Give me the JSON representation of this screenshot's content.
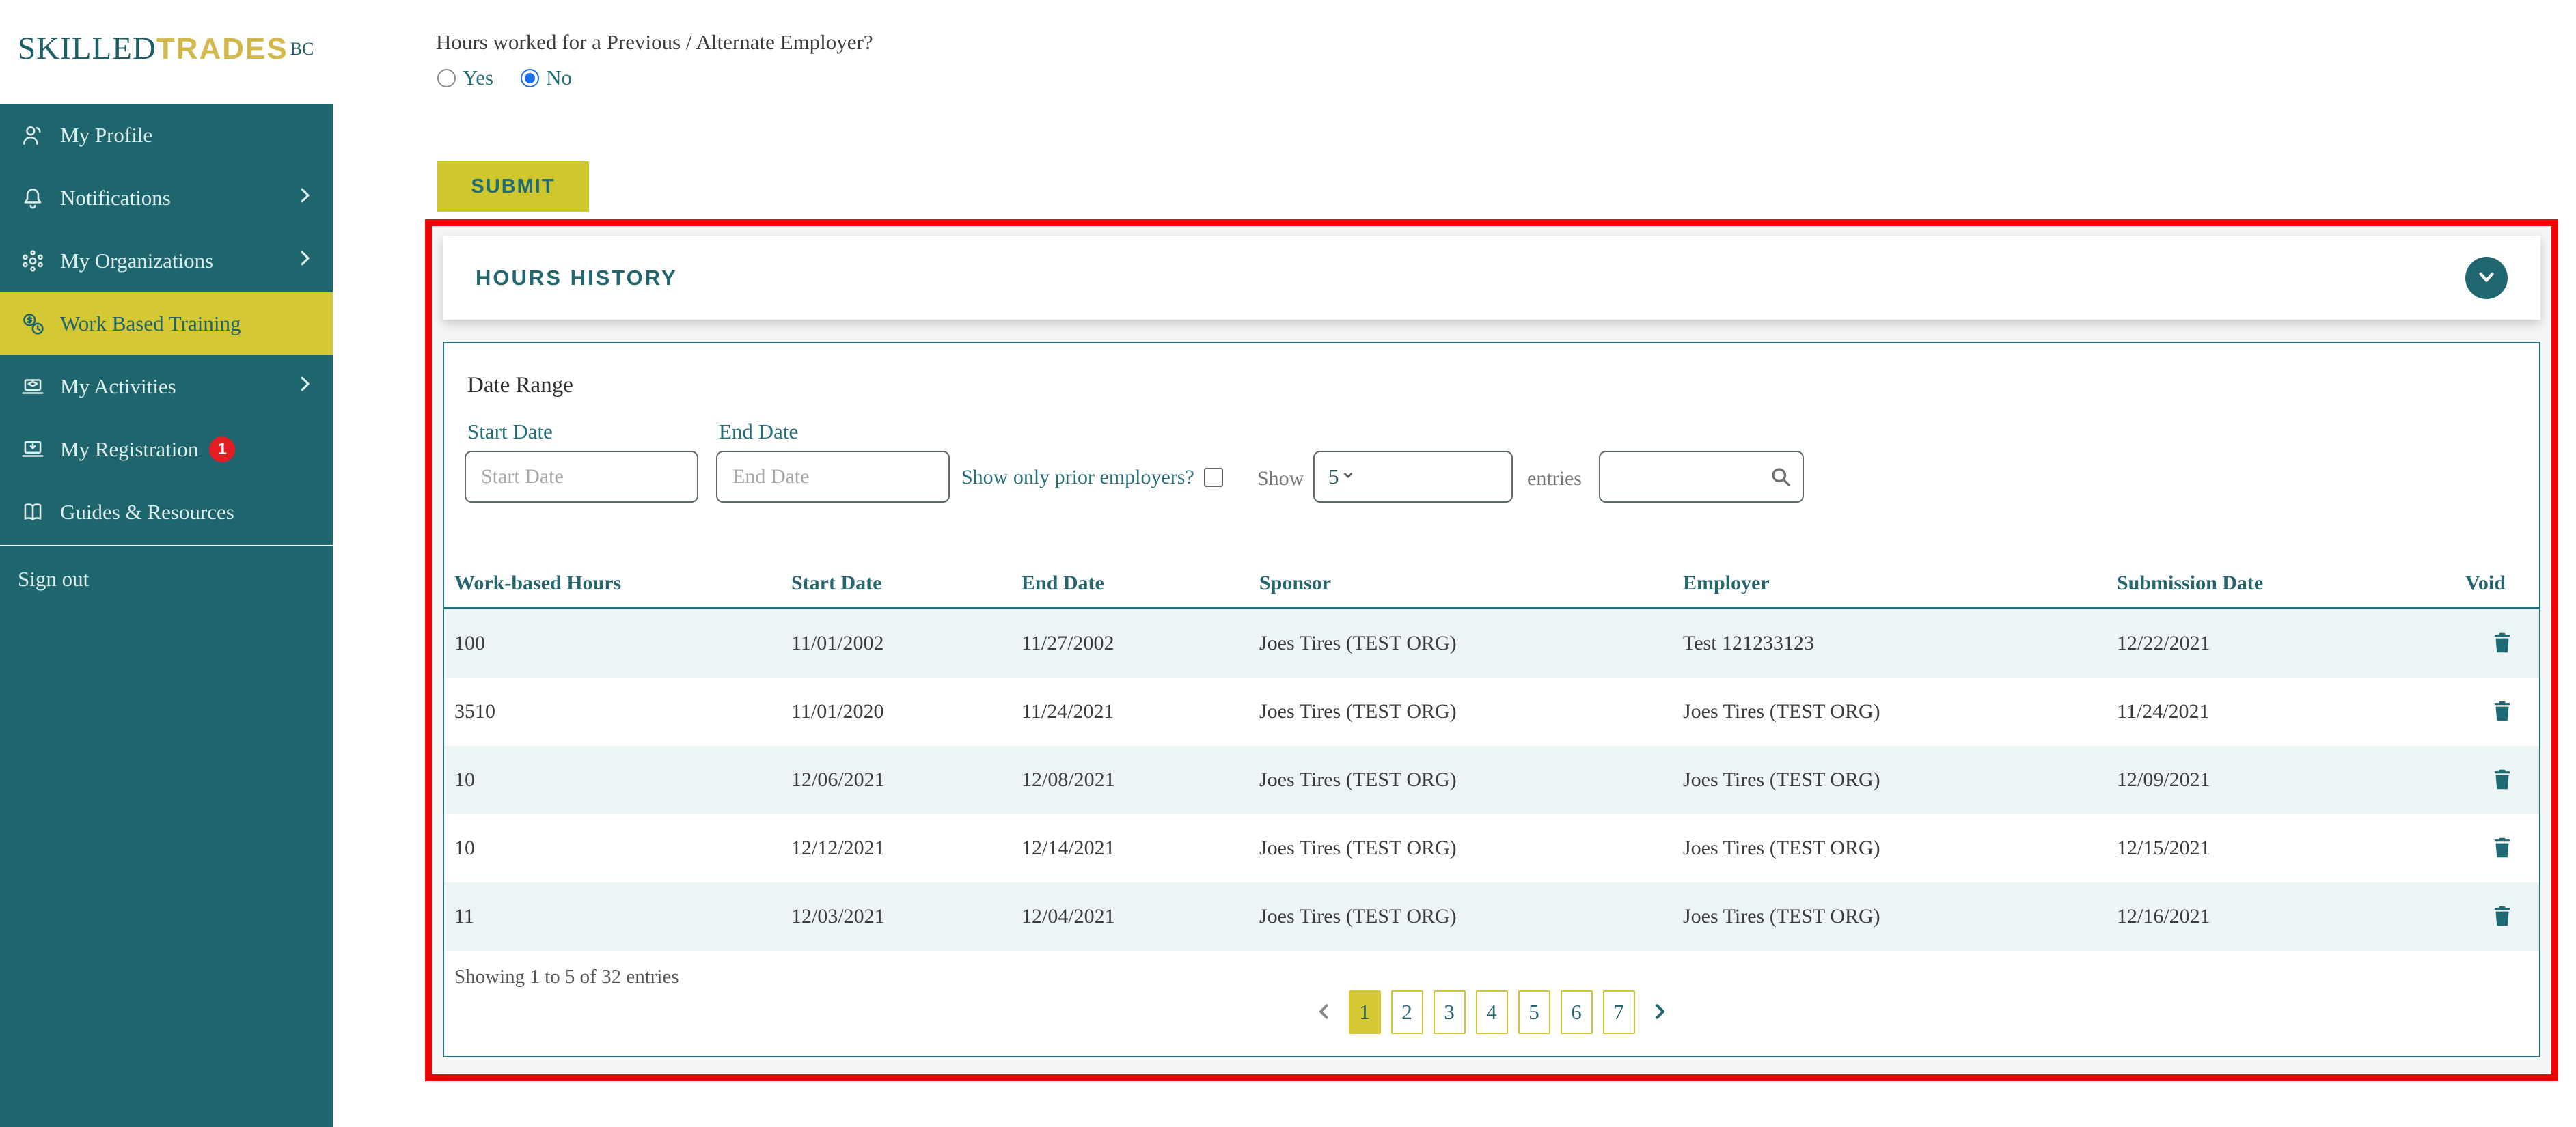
{
  "brand": {
    "skilled": "SKILLED",
    "trades": "TRADES",
    "bc": "BC"
  },
  "colors": {
    "sidebar_teal": "#1f656d",
    "active_yellow": "#d4c935",
    "submit_yellow": "#cfc72e",
    "logo_gold": "#d2b84b",
    "accent_teal_text": "#266e77",
    "highlight_red_border": "#ee0505",
    "badge_red": "#e41c23",
    "row_stripe": "#edf4f6",
    "radio_selected_blue": "#1a6fe8"
  },
  "sidebar": {
    "items": [
      {
        "label": "My Profile",
        "icon": "person-icon",
        "expandable": false,
        "active": false
      },
      {
        "label": "Notifications",
        "icon": "bell-icon",
        "expandable": true,
        "active": false
      },
      {
        "label": "My Organizations",
        "icon": "network-icon",
        "expandable": true,
        "active": false
      },
      {
        "label": "Work Based Training",
        "icon": "work-training-icon",
        "expandable": false,
        "active": true
      },
      {
        "label": "My Activities",
        "icon": "activities-icon",
        "expandable": true,
        "active": false
      },
      {
        "label": "My Registration",
        "icon": "registration-icon",
        "expandable": false,
        "active": false,
        "badge": "1"
      },
      {
        "label": "Guides & Resources",
        "icon": "guides-icon",
        "expandable": false,
        "active": false
      }
    ],
    "sign_out": "Sign out"
  },
  "form": {
    "question": "Hours worked for a Previous / Alternate Employer?",
    "options": [
      {
        "label": "Yes",
        "selected": false
      },
      {
        "label": "No",
        "selected": true
      }
    ],
    "submit_label": "SUBMIT"
  },
  "hours_history": {
    "title": "HOURS HISTORY",
    "date_range": {
      "heading": "Date Range",
      "start_label": "Start Date",
      "start_placeholder": "Start Date",
      "end_label": "End Date",
      "end_placeholder": "End Date"
    },
    "filters": {
      "prior_label": "Show only prior employers?",
      "prior_checked": false,
      "show_label": "Show",
      "page_size": "5",
      "entries_label": "entries",
      "search_value": ""
    },
    "table": {
      "columns": [
        "Work-based Hours",
        "Start Date",
        "End Date",
        "Sponsor",
        "Employer",
        "Submission Date",
        "Void"
      ],
      "rows": [
        [
          "100",
          "11/01/2002",
          "11/27/2002",
          "Joes Tires (TEST ORG)",
          "Test 121233123",
          "12/22/2021"
        ],
        [
          "3510",
          "11/01/2020",
          "11/24/2021",
          "Joes Tires (TEST ORG)",
          "Joes Tires (TEST ORG)",
          "11/24/2021"
        ],
        [
          "10",
          "12/06/2021",
          "12/08/2021",
          "Joes Tires (TEST ORG)",
          "Joes Tires (TEST ORG)",
          "12/09/2021"
        ],
        [
          "10",
          "12/12/2021",
          "12/14/2021",
          "Joes Tires (TEST ORG)",
          "Joes Tires (TEST ORG)",
          "12/15/2021"
        ],
        [
          "11",
          "12/03/2021",
          "12/04/2021",
          "Joes Tires (TEST ORG)",
          "Joes Tires (TEST ORG)",
          "12/16/2021"
        ]
      ]
    },
    "pagination": {
      "summary": "Showing 1 to 5 of 32 entries",
      "pages": [
        "1",
        "2",
        "3",
        "4",
        "5",
        "6",
        "7"
      ],
      "active_page": "1"
    }
  }
}
